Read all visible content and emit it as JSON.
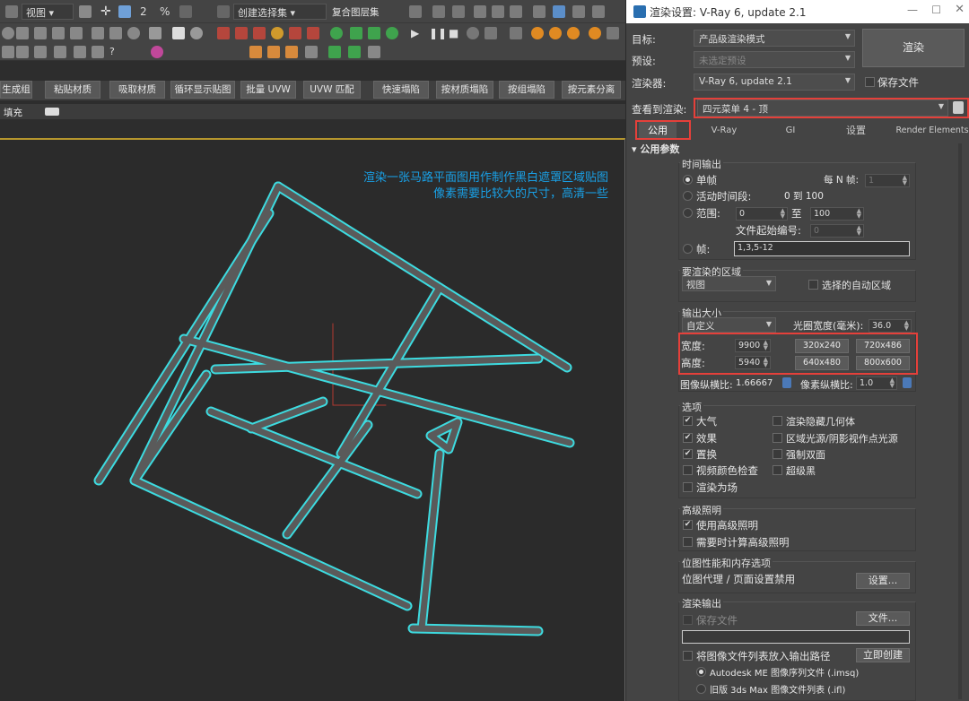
{
  "left_app": {
    "toolbar": {
      "view_dropdown": "视图",
      "selection_set": "创建选择集",
      "restore_layers": "复合图层集"
    },
    "buttons": [
      "生成组",
      "粘贴材质",
      "吸取材质",
      "循环显示贴图",
      "批量 UVW",
      "UVW 匹配",
      "快速塌陷",
      "按材质塌陷",
      "按组塌陷",
      "按元素分离"
    ],
    "fill_label": "填充",
    "viewport_note": {
      "line1": "渲染一张马路平面图用作制作黑白遮罩区域贴图",
      "line2": "像素需要比较大的尺寸，高清一些"
    },
    "road_color": "#3ddbe0"
  },
  "dialog": {
    "title": "渲染设置: V-Ray 6, update 2.1",
    "target_label": "目标:",
    "target_value": "产品级渲染模式",
    "preset_label": "预设:",
    "preset_value": "未选定预设",
    "renderer_label": "渲染器:",
    "renderer_value": "V-Ray 6, update 2.1",
    "save_file": "保存文件",
    "render_button": "渲染",
    "view_label": "查看到渲染:",
    "view_value": "四元菜单 4 - 顶",
    "tabs": [
      "公用",
      "V-Ray",
      "GI",
      "设置",
      "Render Elements"
    ],
    "rollout_title": "公用参数",
    "time_output": {
      "title": "时间输出",
      "single": "单帧",
      "every_n_label": "每 N 帧:",
      "every_n_value": "1",
      "active_segment": "活动时间段:",
      "active_range": "0 到 100",
      "range_label": "范围:",
      "range_from": "0",
      "range_to_word": "至",
      "range_to": "100",
      "file_start_label": "文件起始编号:",
      "file_start_value": "0",
      "frames_label": "帧:",
      "frames_value": "1,3,5-12"
    },
    "area": {
      "title": "要渲染的区域",
      "mode": "视图",
      "auto_region": "选择的自动区域"
    },
    "output_size": {
      "title": "输出大小",
      "preset": "自定义",
      "aperture_label": "光圈宽度(毫米):",
      "aperture_value": "36.0",
      "width_label": "宽度:",
      "width_value": "9900",
      "height_label": "高度:",
      "height_value": "5940",
      "size_buttons": [
        "320x240",
        "720x486",
        "640x480",
        "800x600"
      ],
      "aspect_label": "图像纵横比:",
      "aspect_value": "1.66667",
      "pixel_aspect_label": "像素纵横比:",
      "pixel_aspect_value": "1.0"
    },
    "options": {
      "title": "选项",
      "left": [
        {
          "label": "大气",
          "checked": true
        },
        {
          "label": "效果",
          "checked": true
        },
        {
          "label": "置换",
          "checked": true
        },
        {
          "label": "视频颜色检查",
          "checked": false
        },
        {
          "label": "渲染为场",
          "checked": false
        }
      ],
      "right": [
        {
          "label": "渲染隐藏几何体",
          "checked": false
        },
        {
          "label": "区域光源/阴影视作点光源",
          "checked": false
        },
        {
          "label": "强制双面",
          "checked": false
        },
        {
          "label": "超级黑",
          "checked": false
        }
      ]
    },
    "advanced_lighting": {
      "title": "高级照明",
      "use": "使用高级照明",
      "compute": "需要时计算高级照明"
    },
    "bitmap": {
      "title": "位图性能和内存选项",
      "proxy_text": "位图代理 / 页面设置禁用",
      "setup_button": "设置..."
    },
    "render_output": {
      "title": "渲染输出",
      "save_file": "保存文件",
      "files_button": "文件...",
      "put_list": "将图像文件列表放入输出路径",
      "create_now": "立即创建",
      "autodesk": "Autodesk ME 图像序列文件 (.imsq)",
      "legacy": "旧版 3ds Max 图像文件列表 (.ifl)"
    }
  }
}
